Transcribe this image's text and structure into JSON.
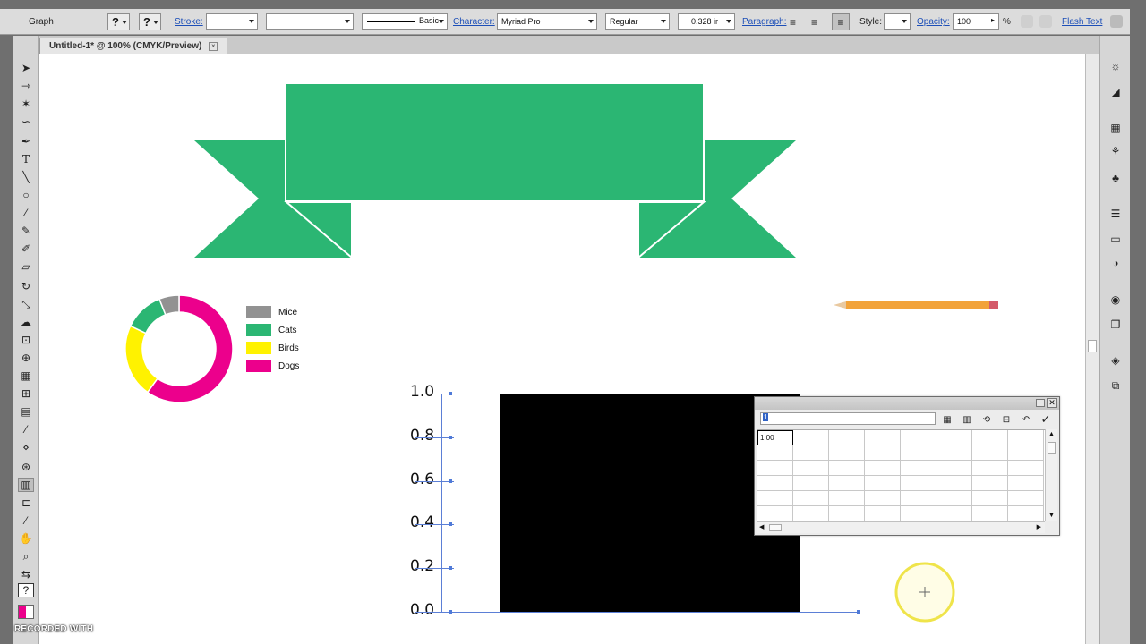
{
  "control_bar": {
    "tool_name": "Graph",
    "help_1": "?",
    "help_2": "?",
    "stroke_label": "Stroke:",
    "brush_label": "Basic",
    "character_label": "Character:",
    "font_family": "Myriad Pro",
    "font_style": "Regular",
    "font_size": "0.328 ir",
    "paragraph_label": "Paragraph:",
    "style_label": "Style:",
    "opacity_label": "Opacity:",
    "opacity_value": "100",
    "opacity_unit": "%",
    "flash_text_label": "Flash Text"
  },
  "document": {
    "tab_title": "Untitled-1* @ 100% (CMYK/Preview)",
    "close_glyph": "×"
  },
  "artwork": {
    "ribbon_color": "#2bb673",
    "pencil_color": "#f2a33a"
  },
  "chart_data": [
    {
      "type": "pie",
      "title": "",
      "style": "donut",
      "categories": [
        "Mice",
        "Cats",
        "Birds",
        "Dogs"
      ],
      "values": [
        6,
        12,
        22,
        60
      ],
      "colors": [
        "#929292",
        "#2bb673",
        "#fff200",
        "#ec008c"
      ],
      "legend": "right"
    },
    {
      "type": "bar",
      "title": "",
      "xlabel": "",
      "ylabel": "",
      "ylim": [
        0,
        1
      ],
      "yticks": [
        "0.0",
        "0.2",
        "0.4",
        "0.6",
        "0.8",
        "1.0"
      ],
      "values": [
        1.0
      ],
      "bar_color": "#000000",
      "grid": false
    }
  ],
  "graph_data_window": {
    "entry_value": "1",
    "cell_value": "1.00"
  },
  "watermark": "RECORDED WITH"
}
